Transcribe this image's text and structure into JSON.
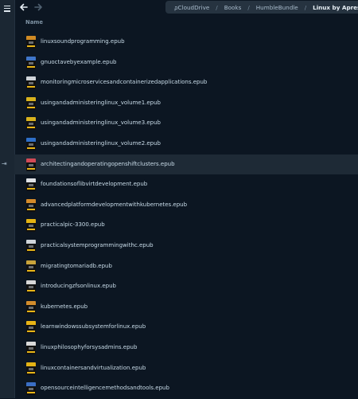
{
  "breadcrumb": [
    "pCloudDrive",
    "Books",
    "HumbleBundle",
    "Linux by Apress"
  ],
  "column_header": "Name",
  "files": [
    {
      "name": "linuxsoundprogramming.epub",
      "cover": "#d08a24"
    },
    {
      "name": "gnuoctavebyexample.epub",
      "cover": "#3f75c8"
    },
    {
      "name": "monitoringmicroservicesandcontainerizedapplications.epub",
      "cover": "#cfd4d9"
    },
    {
      "name": "usingandadministeringlinux_volume1.epub",
      "cover": "#d8b21d"
    },
    {
      "name": "usingandadministeringlinux_volume3.epub",
      "cover": "#d8b21d"
    },
    {
      "name": "usingandadministeringlinux_volume2.epub",
      "cover": "#2e6fc8"
    },
    {
      "name": "architectingandoperatingopenshiftclusters.epub",
      "cover": "#d24a56"
    },
    {
      "name": "foundationsoflibvirtdevelopment.epub",
      "cover": "#e0e3e6"
    },
    {
      "name": "advancedplatformdevelopmentwithkubernetes.epub",
      "cover": "#d58b2a"
    },
    {
      "name": "practicalpic-3300.epub",
      "cover": "#e5b312"
    },
    {
      "name": "practicalsystemprogrammingwithc.epub",
      "cover": "#cfd4d9"
    },
    {
      "name": "migratingtomariadb.epub",
      "cover": "#c9a33b"
    },
    {
      "name": "introducingzfsonlinux.epub",
      "cover": "#d8d8d8"
    },
    {
      "name": "kubernetes.epub",
      "cover": "#d38c2b"
    },
    {
      "name": "learnwindowssubsystemforlinux.epub",
      "cover": "#e8b315"
    },
    {
      "name": "linuxphilosophyforsysadmins.epub",
      "cover": "#d9d9d9"
    },
    {
      "name": "linuxcontainersandvirtualization.epub",
      "cover": "#e3b215"
    },
    {
      "name": "opensourceintelligencemethodsandtools.epub",
      "cover": "#3a6ec4"
    }
  ],
  "highlighted_row": 6,
  "accent_color": "#e9b516"
}
